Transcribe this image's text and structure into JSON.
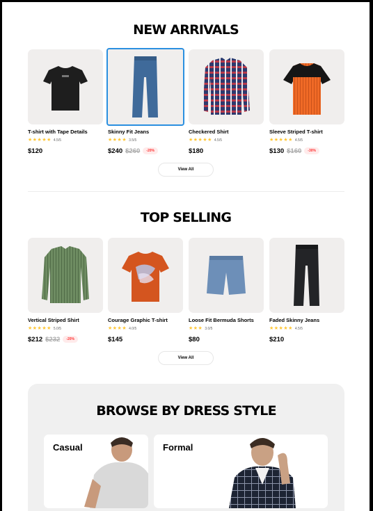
{
  "new_arrivals": {
    "title": "NEW ARRIVALS",
    "products": [
      {
        "name": "T-shirt with Tape Details",
        "stars": "★★★★★",
        "rating": "4.5/5",
        "price": "$120",
        "old_price": "",
        "discount": ""
      },
      {
        "name": "Skinny Fit Jeans",
        "stars": "★★★★",
        "rating": "3.5/5",
        "price": "$240",
        "old_price": "$260",
        "discount": "-20%"
      },
      {
        "name": "Checkered Shirt",
        "stars": "★★★★★",
        "rating": "4.5/5",
        "price": "$180",
        "old_price": "",
        "discount": ""
      },
      {
        "name": "Sleeve Striped T-shirt",
        "stars": "★★★★★",
        "rating": "4.5/5",
        "price": "$130",
        "old_price": "$160",
        "discount": "-30%"
      }
    ],
    "view_all": "View All"
  },
  "top_selling": {
    "title": "TOP SELLING",
    "products": [
      {
        "name": "Vertical Striped Shirt",
        "stars": "★★★★★",
        "rating": "5.0/5",
        "price": "$212",
        "old_price": "$232",
        "discount": "-20%"
      },
      {
        "name": "Courage Graphic T-shirt",
        "stars": "★★★★",
        "rating": "4.0/5",
        "price": "$145",
        "old_price": "",
        "discount": ""
      },
      {
        "name": "Loose Fit Bermuda Shorts",
        "stars": "★★★",
        "rating": "3.0/5",
        "price": "$80",
        "old_price": "",
        "discount": ""
      },
      {
        "name": "Faded Skinny Jeans",
        "stars": "★★★★★",
        "rating": "4.5/5",
        "price": "$210",
        "old_price": "",
        "discount": ""
      }
    ],
    "view_all": "View All"
  },
  "browse": {
    "title": "BROWSE BY DRESS STYLE",
    "styles": [
      "Casual",
      "Formal"
    ]
  },
  "colors": {
    "star": "#ffc633",
    "discount_text": "#ff3333",
    "discount_bg": "#ffebeb",
    "selected_outline": "#2a8fe0"
  }
}
